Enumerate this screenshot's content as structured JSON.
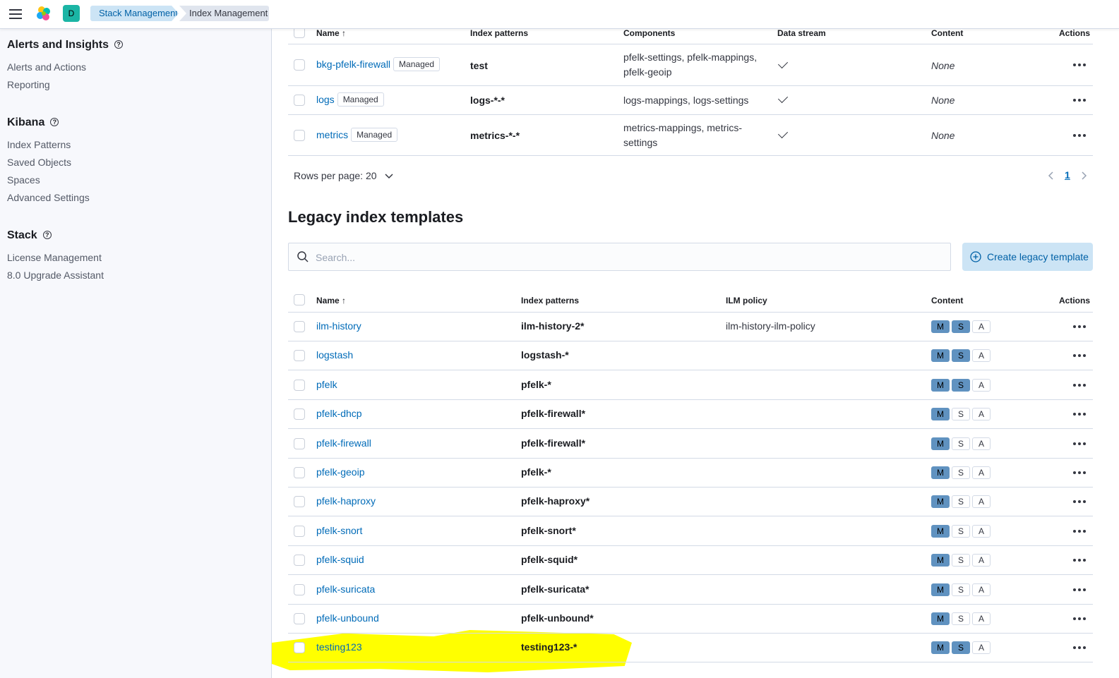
{
  "header": {
    "breadcrumbs": [
      "Stack Management",
      "Index Management"
    ],
    "space_initial": "D"
  },
  "sidebar": {
    "groups": [
      {
        "title": "Alerts and Insights",
        "items": [
          "Alerts and Actions",
          "Reporting"
        ]
      },
      {
        "title": "Kibana",
        "items": [
          "Index Patterns",
          "Saved Objects",
          "Spaces",
          "Advanced Settings"
        ]
      },
      {
        "title": "Stack",
        "items": [
          "License Management",
          "8.0 Upgrade Assistant"
        ]
      }
    ]
  },
  "composable": {
    "columns": [
      "Name",
      "Index patterns",
      "Components",
      "Data stream",
      "Content",
      "Actions"
    ],
    "rows": [
      {
        "name": "bkg-pfelk-firewall",
        "badge": "Managed",
        "pattern": "test",
        "components_l1": "pfelk-settings, pfelk-mappings,",
        "components_l2": "pfelk-geoip",
        "content": "None"
      },
      {
        "name": "logs",
        "badge": "Managed",
        "pattern": "logs-*-*",
        "components_l1": "logs-mappings, logs-settings",
        "components_l2": "",
        "content": "None"
      },
      {
        "name": "metrics",
        "badge": "Managed",
        "pattern": "metrics-*-*",
        "components_l1": "metrics-mappings, metrics-",
        "components_l2": "settings",
        "content": "None"
      }
    ],
    "rows_per_page": "Rows per page: 20",
    "page": "1"
  },
  "legacy": {
    "title": "Legacy index templates",
    "search_placeholder": "Search...",
    "create_label": "Create legacy template",
    "columns": [
      "Name",
      "Index patterns",
      "ILM policy",
      "Content",
      "Actions"
    ],
    "pill_labels": [
      "M",
      "S",
      "A"
    ],
    "rows": [
      {
        "name": "ilm-history",
        "pattern": "ilm-history-2*",
        "ilm": "ilm-history-ilm-policy",
        "m": true,
        "s": true,
        "a": false
      },
      {
        "name": "logstash",
        "pattern": "logstash-*",
        "ilm": "",
        "m": true,
        "s": true,
        "a": false
      },
      {
        "name": "pfelk",
        "pattern": "pfelk-*",
        "ilm": "",
        "m": true,
        "s": true,
        "a": false
      },
      {
        "name": "pfelk-dhcp",
        "pattern": "pfelk-firewall*",
        "ilm": "",
        "m": true,
        "s": false,
        "a": false
      },
      {
        "name": "pfelk-firewall",
        "pattern": "pfelk-firewall*",
        "ilm": "",
        "m": true,
        "s": false,
        "a": false
      },
      {
        "name": "pfelk-geoip",
        "pattern": "pfelk-*",
        "ilm": "",
        "m": true,
        "s": false,
        "a": false
      },
      {
        "name": "pfelk-haproxy",
        "pattern": "pfelk-haproxy*",
        "ilm": "",
        "m": true,
        "s": false,
        "a": false
      },
      {
        "name": "pfelk-snort",
        "pattern": "pfelk-snort*",
        "ilm": "",
        "m": true,
        "s": false,
        "a": false
      },
      {
        "name": "pfelk-squid",
        "pattern": "pfelk-squid*",
        "ilm": "",
        "m": true,
        "s": false,
        "a": false
      },
      {
        "name": "pfelk-suricata",
        "pattern": "pfelk-suricata*",
        "ilm": "",
        "m": true,
        "s": false,
        "a": false
      },
      {
        "name": "pfelk-unbound",
        "pattern": "pfelk-unbound*",
        "ilm": "",
        "m": true,
        "s": false,
        "a": false
      },
      {
        "name": "testing123",
        "pattern": "testing123-*",
        "ilm": "",
        "m": true,
        "s": true,
        "a": false
      }
    ]
  },
  "colors": {
    "accent": "#006bb8",
    "highlight": "#ffff00",
    "pill_on": "#6092c0"
  }
}
